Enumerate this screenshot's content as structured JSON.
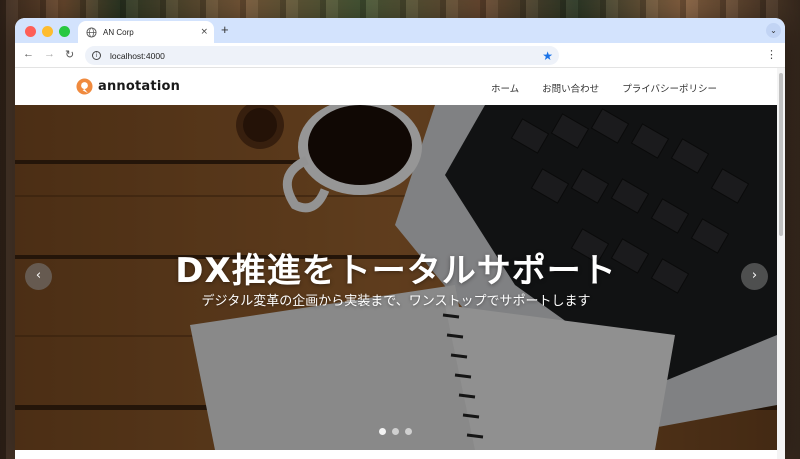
{
  "browser": {
    "tab_title": "AN Corp",
    "tab_close": "×",
    "new_tab": "+",
    "url": "localhost:4000",
    "tab_menu": "⌄",
    "kebab": "⋮"
  },
  "site": {
    "logo_text": "annotation",
    "nav": [
      "ホーム",
      "お問い合わせ",
      "プライバシーポリシー"
    ]
  },
  "hero": {
    "title": "DX推進をトータルサポート",
    "subtitle": "デジタル変革の企画から実装まで、ワンストップでサポートします",
    "prev_label": "‹",
    "next_label": "›",
    "slide_count": 3,
    "active_slide": 1
  },
  "colors": {
    "tabstrip": "#d3e3fd",
    "logo_accent": "#f08a3e",
    "star": "#1a73e8"
  }
}
